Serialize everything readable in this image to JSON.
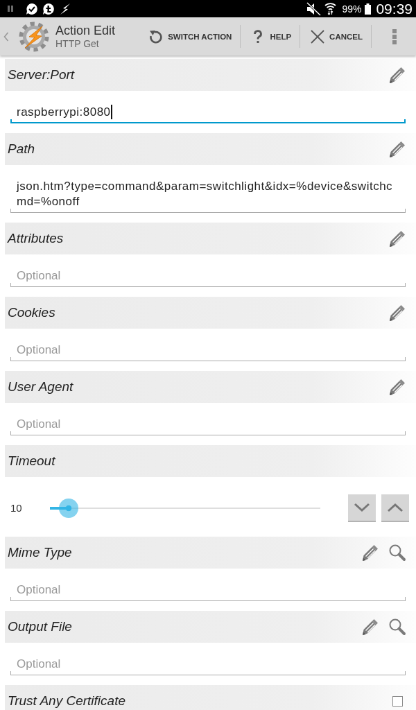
{
  "status_bar": {
    "battery": "99%",
    "time": "09:39"
  },
  "action_bar": {
    "title": "Action Edit",
    "subtitle": "HTTP Get",
    "actions": [
      {
        "kind": "switch",
        "label": "SWITCH ACTION"
      },
      {
        "kind": "help",
        "label": "HELP"
      },
      {
        "kind": "cancel",
        "label": "CANCEL"
      }
    ]
  },
  "sections": [
    {
      "kind": "text",
      "label": "Server:Port",
      "value": "raspberrypi:8080",
      "focused": true
    },
    {
      "kind": "text",
      "label": "Path",
      "value": "json.htm?type=command&param=switchlight&idx=%device&switchcmd=%onoff",
      "focused": false
    },
    {
      "kind": "text",
      "label": "Attributes",
      "placeholder": "Optional",
      "focused": false
    },
    {
      "kind": "text",
      "label": "Cookies",
      "placeholder": "Optional",
      "focused": false
    },
    {
      "kind": "text",
      "label": "User Agent",
      "placeholder": "Optional",
      "focused": false
    },
    {
      "kind": "slider",
      "label": "Timeout",
      "reading": "10",
      "level": 0.07
    },
    {
      "kind": "lookup",
      "label": "Mime Type",
      "placeholder": "Optional",
      "focused": false
    },
    {
      "kind": "lookup",
      "label": "Output File",
      "placeholder": "Optional",
      "focused": false
    },
    {
      "kind": "checkbox",
      "label": "Trust Any Certificate",
      "checked": false
    }
  ]
}
